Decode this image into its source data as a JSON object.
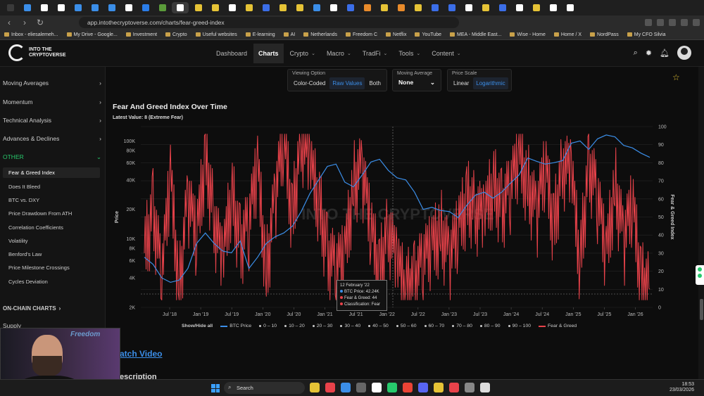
{
  "browser": {
    "tab_colors": [
      "#3a3a3a",
      "#3b8ee8",
      "#ffffff",
      "#ffffff",
      "#3b8ee8",
      "#3b8ee8",
      "#3b8ee8",
      "#ffffff",
      "#2b7de9",
      "#5b9b3a",
      "#ffffff",
      "#e6c336",
      "#e6c336",
      "#ffffff",
      "#e6c336",
      "#3b6ee8",
      "#e6c336",
      "#e6c336",
      "#3b8ee8",
      "#ffffff",
      "#3b6ee8",
      "#e98b2b",
      "#e6c336",
      "#e98b2b",
      "#e6c336",
      "#3b6ee8",
      "#3b6ee8",
      "#ffffff",
      "#e6c336",
      "#3b6ee8",
      "#ffffff",
      "#e6c336",
      "#ffffff",
      "#ffffff"
    ],
    "url": "app.intothecryptoverse.com/charts/fear-greed-index",
    "bookmarks": [
      "Inbox - eliesalemeh...",
      "My Drive - Google...",
      "Investment",
      "Crypto",
      "Useful websites",
      "E-learning",
      "AI",
      "Netherlands",
      "Freedom C",
      "Netflix",
      "YouTube",
      "MEA - Middle East...",
      "Wise - Home",
      "Home / X",
      "NordPass",
      "My CFO Silvia"
    ]
  },
  "header": {
    "logo_text": "INTO THE CRYPTOVERSE",
    "nav": [
      {
        "label": "Dashboard",
        "dropdown": false
      },
      {
        "label": "Charts",
        "dropdown": false,
        "active": true
      },
      {
        "label": "Crypto",
        "dropdown": true
      },
      {
        "label": "Macro",
        "dropdown": true
      },
      {
        "label": "TradFi",
        "dropdown": true
      },
      {
        "label": "Tools",
        "dropdown": true
      },
      {
        "label": "Content",
        "dropdown": true
      }
    ]
  },
  "sidebar": {
    "sections": [
      "Moving Averages",
      "Momentum",
      "Technical Analysis",
      "Advances & Declines"
    ],
    "other_label": "OTHER",
    "sub_items": [
      "Fear & Greed Index",
      "Does It Bleed",
      "BTC vs. DXY",
      "Price Drawdown From ATH",
      "Correlation Coefficients",
      "Volatility",
      "Benford's Law",
      "Price Milestone Crossings",
      "Cycles Deviation"
    ],
    "onchain_label": "ON-CHAIN CHARTS",
    "supply_label": "Supply"
  },
  "controls": {
    "viewing_option": {
      "label": "Viewing Option",
      "options": [
        "Color-Coded",
        "Raw Values",
        "Both"
      ],
      "selected": "Raw Values"
    },
    "moving_average": {
      "label": "Moving Average",
      "value": "None"
    },
    "price_scale": {
      "label": "Price Scale",
      "options": [
        "Linear",
        "Logarithmic"
      ],
      "selected": "Logarithmic"
    }
  },
  "chart_title": "Fear And Greed Index Over Time",
  "latest_value": "Latest Value: 8 (Extreme Fear)",
  "chart_data": {
    "type": "line",
    "x_ticks": [
      "Jul '18",
      "Jan '19",
      "Jul '19",
      "Jan '20",
      "Jul '20",
      "Jan '21",
      "Jul '21",
      "Jan '22",
      "Jul '22",
      "Jan '23",
      "Jul '23",
      "Jan '24",
      "Jul '24",
      "Jan '25",
      "Jul '25",
      "Jan '26"
    ],
    "y_left": {
      "label": "Price",
      "scale": "log",
      "ticks": [
        "2K",
        "4K",
        "6K",
        "8K",
        "10K",
        "20K",
        "40K",
        "60K",
        "80K",
        "100K"
      ],
      "range": [
        2000,
        140000
      ]
    },
    "y_right": {
      "label": "Fear & Greed Index",
      "ticks": [
        "0",
        "10",
        "20",
        "30",
        "40",
        "50",
        "60",
        "70",
        "80",
        "90",
        "100"
      ],
      "range": [
        0,
        100
      ]
    },
    "series": [
      {
        "name": "BTC Price",
        "color": "#3b8ee8",
        "values": [
          6500,
          5500,
          4000,
          3600,
          3800,
          5000,
          9000,
          11500,
          9000,
          7500,
          7200,
          9500,
          5000,
          6500,
          9000,
          10500,
          11500,
          13500,
          19000,
          29000,
          40000,
          55000,
          58000,
          38000,
          34000,
          45000,
          61000,
          65000,
          50000,
          42000,
          40000,
          30000,
          20000,
          21000,
          19500,
          19000,
          16500,
          22000,
          28000,
          30000,
          26000,
          30000,
          37000,
          45000,
          67000,
          62000,
          58000,
          60000,
          63000,
          95000,
          100000,
          82000,
          105000,
          115000,
          110000,
          90000,
          85000,
          75000,
          68000
        ]
      },
      {
        "name": "Fear & Greed",
        "color": "#e8424a",
        "values": [
          30,
          55,
          15,
          70,
          10,
          60,
          35,
          85,
          50,
          20,
          65,
          35,
          45,
          75,
          20,
          60,
          90,
          50,
          95,
          75,
          60,
          30,
          20,
          25,
          70,
          75,
          40,
          20,
          45,
          20,
          10,
          15,
          25,
          30,
          45,
          25,
          40,
          60,
          55,
          45,
          70,
          55,
          65,
          80,
          70,
          50,
          75,
          45,
          80,
          70,
          25,
          80,
          60,
          25,
          70,
          35,
          55,
          15,
          10
        ]
      }
    ],
    "legend": [
      "Show/Hide all",
      "BTC Price",
      "0 – 10",
      "10 – 20",
      "20 – 30",
      "30 – 40",
      "40 – 50",
      "50 – 60",
      "60 – 70",
      "70 – 80",
      "80 – 90",
      "90 – 100",
      "Fear & Greed"
    ]
  },
  "tooltip": {
    "date": "12 February '22",
    "btc_label": "BTC Price: 42.24K",
    "fg_label": "Fear & Greed: 44",
    "class_label": "Classification: Fear"
  },
  "watermark": "INTO THE CRYPTOVERSE",
  "watch_video": "atch Video",
  "description": "escription",
  "webcam_sign": "Freedom",
  "taskbar": {
    "search": "Search",
    "time": "18:53",
    "date": "23/03/2026"
  }
}
